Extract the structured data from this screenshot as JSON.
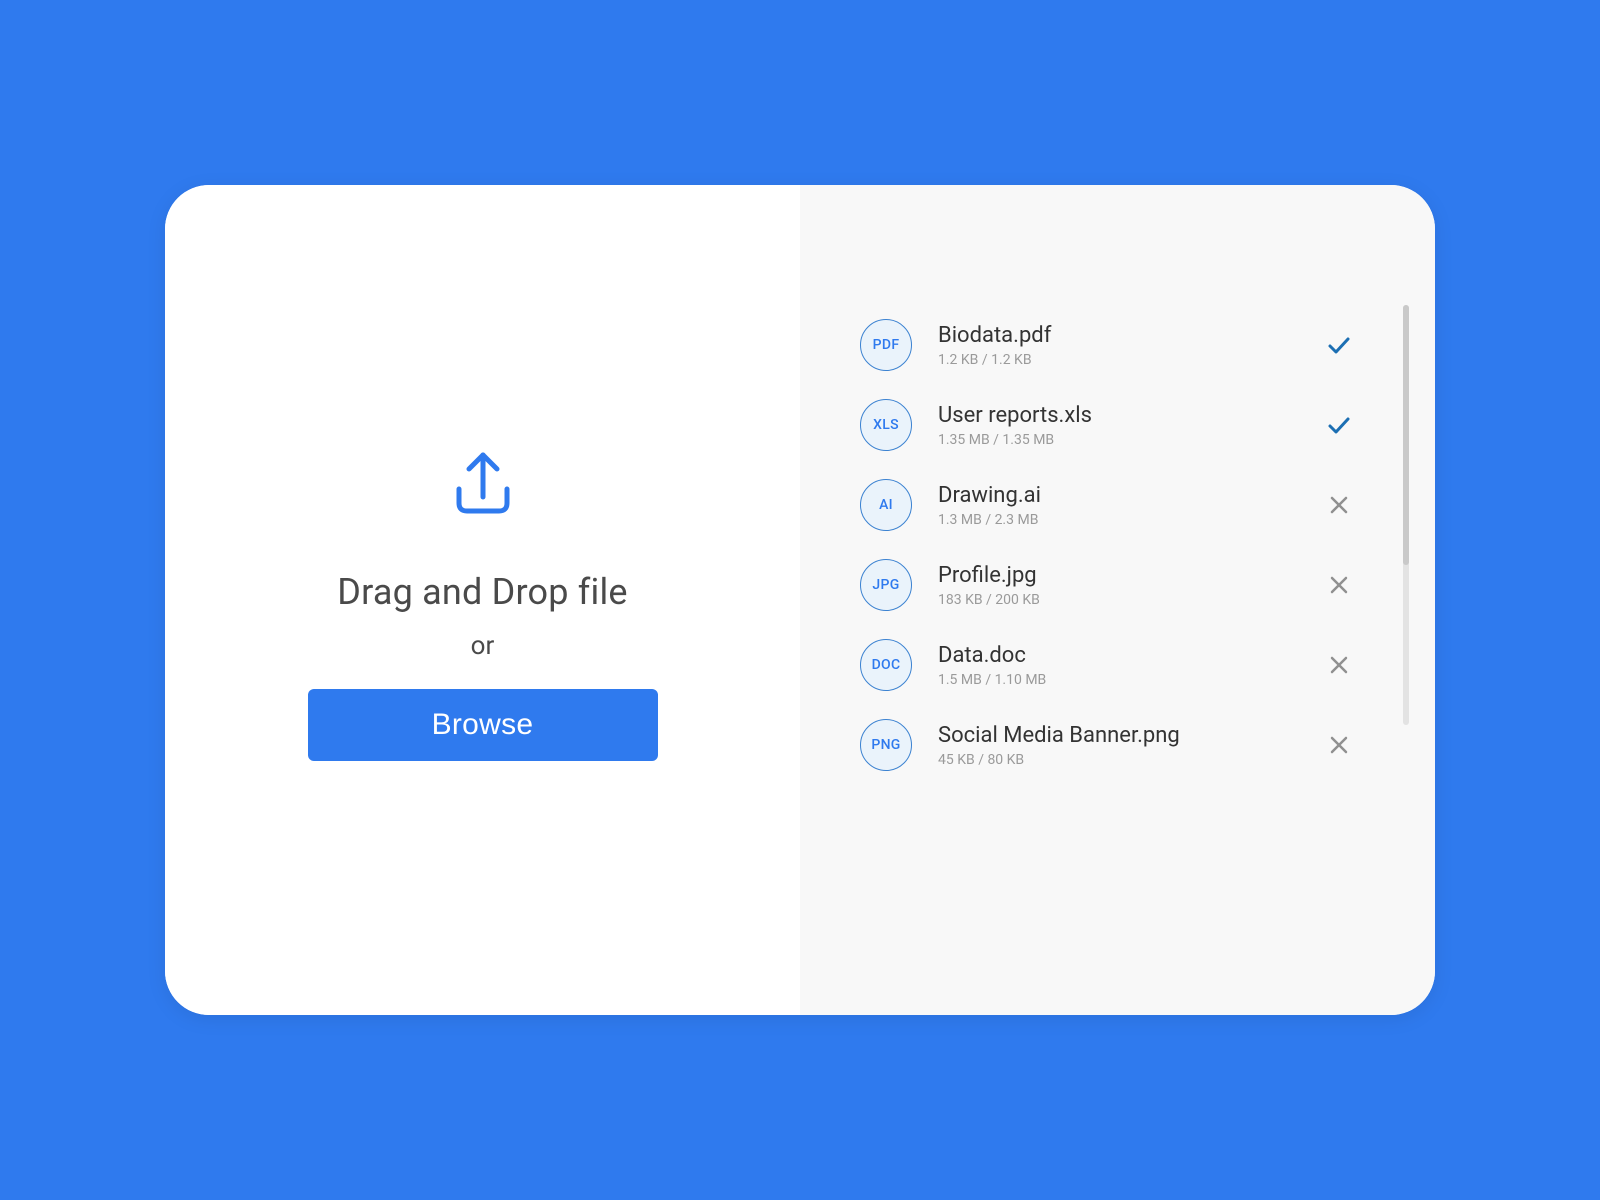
{
  "dropzone": {
    "heading": "Drag and Drop file",
    "or": "or",
    "browse_label": "Browse"
  },
  "files": [
    {
      "ext": "PDF",
      "name": "Biodata.pdf",
      "size": "1.2 KB / 1.2 KB",
      "status": "done"
    },
    {
      "ext": "XLS",
      "name": "User reports.xls",
      "size": "1.35 MB / 1.35 MB",
      "status": "done"
    },
    {
      "ext": "AI",
      "name": "Drawing.ai",
      "size": "1.3 MB / 2.3 MB",
      "status": "cancel"
    },
    {
      "ext": "JPG",
      "name": "Profile.jpg",
      "size": "183 KB / 200 KB",
      "status": "cancel"
    },
    {
      "ext": "DOC",
      "name": "Data.doc",
      "size": "1.5 MB / 1.10 MB",
      "status": "cancel"
    },
    {
      "ext": "PNG",
      "name": "Social Media Banner.png",
      "size": "45 KB / 80 KB",
      "status": "cancel"
    }
  ],
  "colors": {
    "accent": "#2f7aee",
    "check": "#1c6fb3",
    "close": "#909090"
  }
}
